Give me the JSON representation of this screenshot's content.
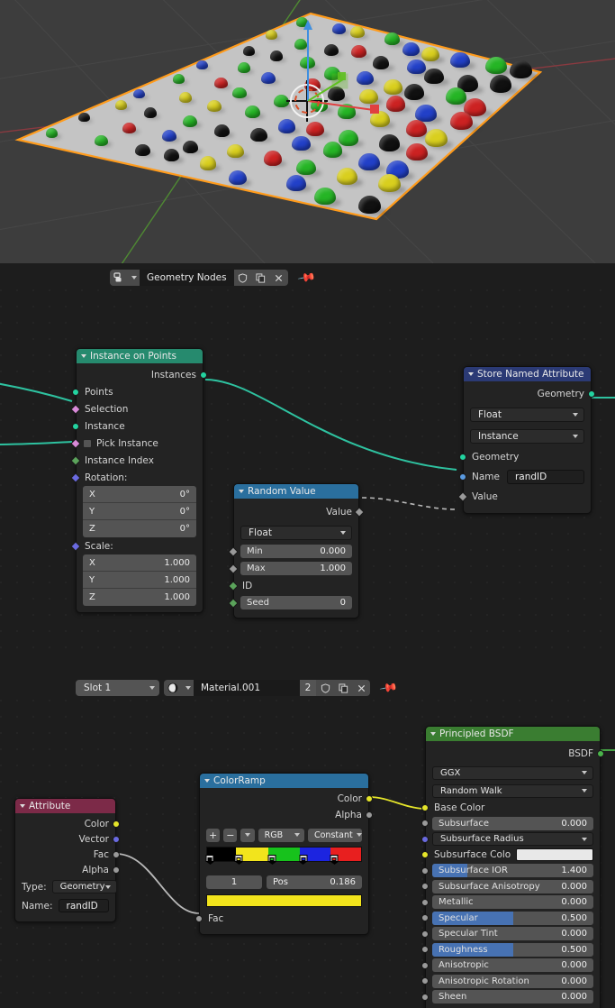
{
  "viewport": {
    "name": "3d-viewport",
    "object_outline_color": "#ff9b1b",
    "background_color": "#3d3d3d",
    "plane_color": "#c4c4c4",
    "instance_colors": [
      "#111111",
      "#d9cf1e",
      "#25b525",
      "#2240c8",
      "#cc2222"
    ],
    "cursor_label": "3D Cursor",
    "gizmo": {
      "x_color": "#e04040",
      "y_color": "#5fc020",
      "z_color": "#3f8fe0"
    }
  },
  "geometry_editor": {
    "header": {
      "editor_type_icon": "geometry-nodes-icon",
      "tree_name": "Geometry Nodes",
      "shield_icon": "fake-user-icon",
      "copy_icon": "new-copy-icon",
      "close_icon": "unlink-icon",
      "pin_icon": "pin-icon"
    },
    "nodes": {
      "instance_on_points": {
        "title": "Instance on Points",
        "header_color": "#268a6e",
        "outputs": [
          {
            "label": "Instances",
            "color": "#23d3a0",
            "shape": "round"
          }
        ],
        "inputs": [
          {
            "label": "Points",
            "color": "#23d3a0",
            "shape": "round"
          },
          {
            "label": "Selection",
            "color": "#d98ad9",
            "shape": "dia"
          },
          {
            "label": "Instance",
            "color": "#23d3a0",
            "shape": "round"
          },
          {
            "label": "Pick Instance",
            "color": "#d98ad9",
            "shape": "dia",
            "checkbox": true
          },
          {
            "label": "Instance Index",
            "color": "#5ba35b",
            "shape": "dia"
          },
          {
            "label": "Rotation:",
            "color": "#6a6ae0",
            "shape": "dia"
          },
          {
            "label": "Scale:",
            "color": "#6a6ae0",
            "shape": "dia"
          }
        ],
        "rotation": [
          {
            "axis": "X",
            "value": "0°"
          },
          {
            "axis": "Y",
            "value": "0°"
          },
          {
            "axis": "Z",
            "value": "0°"
          }
        ],
        "scale": [
          {
            "axis": "X",
            "value": "1.000"
          },
          {
            "axis": "Y",
            "value": "1.000"
          },
          {
            "axis": "Z",
            "value": "1.000"
          }
        ]
      },
      "random_value": {
        "title": "Random Value",
        "header_color": "#2a6f9e",
        "output_label": "Value",
        "data_type": "Float",
        "min_label": "Min",
        "min_value": "0.000",
        "max_label": "Max",
        "max_value": "1.000",
        "id_label": "ID",
        "seed_label": "Seed",
        "seed_value": "0"
      },
      "store_named_attribute": {
        "title": "Store Named Attribute",
        "header_color": "#2b3a75",
        "output_label": "Geometry",
        "data_type": "Float",
        "domain": "Instance",
        "geometry_label": "Geometry",
        "name_label": "Name",
        "name_value": "randID",
        "value_label": "Value"
      }
    }
  },
  "material_editor": {
    "header": {
      "slot_label": "Slot 1",
      "material_icon": "material-sphere-icon",
      "material_name": "Material.001",
      "user_count": "2",
      "shield_icon": "fake-user-icon",
      "copy_icon": "new-copy-icon",
      "close_icon": "unlink-icon",
      "pin_icon": "pin-icon"
    },
    "nodes": {
      "attribute": {
        "title": "Attribute",
        "header_color": "#7c2a48",
        "outputs": [
          {
            "label": "Color",
            "color": "#e5e52a"
          },
          {
            "label": "Vector",
            "color": "#6a6ae0"
          },
          {
            "label": "Fac",
            "color": "#9a9a9a"
          },
          {
            "label": "Alpha",
            "color": "#9a9a9a"
          }
        ],
        "type_label": "Type:",
        "type_value": "Geometry",
        "name_label": "Name:",
        "name_value": "randID"
      },
      "colorramp": {
        "title": "ColorRamp",
        "header_color": "#2a6f9e",
        "outputs": [
          {
            "label": "Color",
            "color": "#e5e52a"
          },
          {
            "label": "Alpha",
            "color": "#9a9a9a"
          }
        ],
        "add_label": "+",
        "remove_label": "−",
        "menu_label": "v",
        "color_mode": "RGB",
        "interpolation": "Constant",
        "stops": [
          {
            "pos": 0.0,
            "color": "#000000"
          },
          {
            "pos": 0.186,
            "color": "#f2e41c"
          },
          {
            "pos": 0.4,
            "color": "#17c21c"
          },
          {
            "pos": 0.6,
            "color": "#1c24e0"
          },
          {
            "pos": 0.8,
            "color": "#e81f1f"
          }
        ],
        "active_index": "1",
        "pos_label": "Pos",
        "pos_value": "0.186",
        "active_color": "#f2e41c",
        "input_label": "Fac"
      },
      "principled_bsdf": {
        "title": "Principled BSDF",
        "header_color": "#3a7d31",
        "output_label": "BSDF",
        "distribution": "GGX",
        "subsurface_method": "Random Walk",
        "rows": [
          {
            "label": "Base Color",
            "type": "socket-label",
            "color": "#e5e52a"
          },
          {
            "label": "Subsurface",
            "value": "0.000",
            "type": "value",
            "color": "#9a9a9a",
            "fill": 0
          },
          {
            "label": "Subsurface Radius",
            "type": "select",
            "color": "#6a6ae0"
          },
          {
            "label": "Subsurface Colo",
            "type": "swatch",
            "color": "#e5e52a",
            "swatch": "#e8e8e8"
          },
          {
            "label": "Subsurface IOR",
            "value": "1.400",
            "type": "value",
            "color": "#9a9a9a",
            "fill": 0.22
          },
          {
            "label": "Subsurface Anisotropy",
            "value": "0.000",
            "type": "value",
            "color": "#9a9a9a",
            "fill": 0
          },
          {
            "label": "Metallic",
            "value": "0.000",
            "type": "value",
            "color": "#9a9a9a",
            "fill": 0
          },
          {
            "label": "Specular",
            "value": "0.500",
            "type": "value",
            "color": "#9a9a9a",
            "fill": 0.5
          },
          {
            "label": "Specular Tint",
            "value": "0.000",
            "type": "value",
            "color": "#9a9a9a",
            "fill": 0
          },
          {
            "label": "Roughness",
            "value": "0.500",
            "type": "value",
            "color": "#9a9a9a",
            "fill": 0.5
          },
          {
            "label": "Anisotropic",
            "value": "0.000",
            "type": "value",
            "color": "#9a9a9a",
            "fill": 0
          },
          {
            "label": "Anisotropic Rotation",
            "value": "0.000",
            "type": "value",
            "color": "#9a9a9a",
            "fill": 0
          },
          {
            "label": "Sheen",
            "value": "0.000",
            "type": "value",
            "color": "#9a9a9a",
            "fill": 0
          }
        ]
      }
    }
  }
}
